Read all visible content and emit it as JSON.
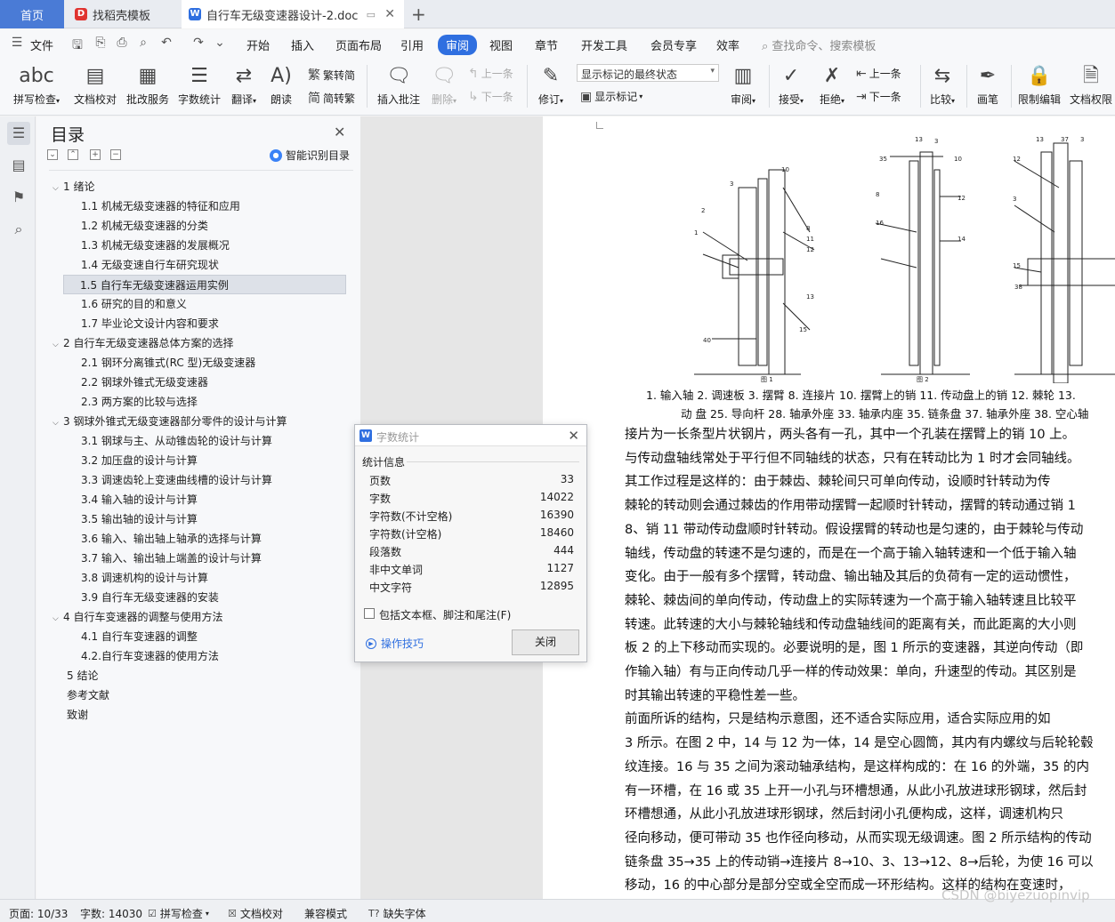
{
  "tabs": {
    "home": "首页",
    "t1": "找稻壳模板",
    "t2": "自行车无级变速器设计-2.doc"
  },
  "menubar": {
    "file": "文件",
    "items": [
      "开始",
      "插入",
      "页面布局",
      "引用",
      "审阅",
      "视图",
      "章节",
      "开发工具",
      "会员专享",
      "效率"
    ],
    "active": "审阅",
    "search_placeholder": "查找命令、搜索模板"
  },
  "ribbon": {
    "spell": "拼写检查",
    "doccheck": "文档校对",
    "batch": "批改服务",
    "wordcount": "字数统计",
    "translate": "翻译",
    "read": "朗读",
    "trad": "繁转简",
    "simp": "简转繁",
    "insert_comment": "插入批注",
    "delete": "删除",
    "prev_comment": "上一条",
    "next_comment": "下一条",
    "revise": "修订",
    "mark_state": "显示标记的最终状态",
    "show_marks": "显示标记",
    "review": "审阅",
    "accept": "接受",
    "reject": "拒绝",
    "prev": "上一条",
    "next": "下一条",
    "compare": "比较",
    "pen": "画笔",
    "restrict": "限制编辑",
    "permission": "文档权限"
  },
  "toc": {
    "title": "目录",
    "smart": "智能识别目录",
    "items": [
      {
        "text": "1 绪论"
      },
      {
        "text": "1.1    机械无级变速器的特征和应用"
      },
      {
        "text": "1.2   机械无级变速器的分类"
      },
      {
        "text": "1.3   机械无级变速器的发展概况"
      },
      {
        "text": "1.4   无级变速自行车研究现状"
      },
      {
        "text": "1.5  自行车无级变速器运用实例"
      },
      {
        "text": "1.6  研究的目的和意义"
      },
      {
        "text": "1.7  毕业论文设计内容和要求"
      },
      {
        "text": "2  自行车无级变速器总体方案的选择"
      },
      {
        "text": "2.1   钢环分离锥式(RC 型)无级变速器"
      },
      {
        "text": "2.2   钢球外锥式无级变速器"
      },
      {
        "text": "2.3   两方案的比较与选择"
      },
      {
        "text": "3  钢球外锥式无级变速器部分零件的设计与计算"
      },
      {
        "text": "3.1   钢球与主、从动锥齿轮的设计与计算"
      },
      {
        "text": "3.2   加压盘的设计与计算"
      },
      {
        "text": "3.3   调速齿轮上变速曲线槽的设计与计算"
      },
      {
        "text": "3.4   输入轴的设计与计算"
      },
      {
        "text": "3.5   输出轴的设计与计算"
      },
      {
        "text": "3.6   输入、输出轴上轴承的选择与计算"
      },
      {
        "text": "3.7   输入、输出轴上端盖的设计与计算"
      },
      {
        "text": "3.8   调速机构的设计与计算"
      },
      {
        "text": "3.9   自行车无级变速器的安装"
      },
      {
        "text": "4  自行车变速器的调整与使用方法"
      },
      {
        "text": "4.1  自行车变速器的调整"
      },
      {
        "text": "4.2.自行车变速器的使用方法"
      },
      {
        "text": "5  结论"
      },
      {
        "text": "参考文献"
      },
      {
        "text": "致谢"
      }
    ]
  },
  "dialog": {
    "title": "字数统计",
    "section": "统计信息",
    "rows": [
      {
        "k": "页数",
        "v": "33"
      },
      {
        "k": "字数",
        "v": "14022"
      },
      {
        "k": "字符数(不计空格)",
        "v": "16390"
      },
      {
        "k": "字符数(计空格)",
        "v": "18460"
      },
      {
        "k": "段落数",
        "v": "444"
      },
      {
        "k": "非中文单词",
        "v": "1127"
      },
      {
        "k": "中文字符",
        "v": "12895"
      }
    ],
    "checkbox": "包括文本框、脚注和尾注(F)",
    "tips": "操作技巧",
    "close": "关闭"
  },
  "doc": {
    "captions": [
      "1. 输入轴  2. 调速板  3. 摆臂  8. 连接片  10. 摆臂上的销  11. 传动盘上的销  12. 棘轮  13.",
      "动  盘  25. 导向杆  28. 轴承外座  33. 轴承内座  35. 链条盘  37. 轴承外座  38. 空心轴"
    ],
    "paragraphs": [
      "接片为一长条型片状钢片，两头各有一孔，其中一个孔装在摆臂上的销 10 上。",
      "与传动盘轴线常处于平行但不同轴线的状态，只有在转动比为 1 时才会同轴线。",
      "    其工作过程是这样的：由于棘齿、棘轮间只可单向传动，设顺时针转动为传",
      "棘轮的转动则会通过棘齿的作用带动摆臂一起顺时针转动，摆臂的转动通过销 1",
      "8、销 11 带动传动盘顺时针转动。假设摆臂的转动也是匀速的，由于棘轮与传动",
      "轴线，传动盘的转速不是匀速的，而是在一个高于输入轴转速和一个低于输入轴",
      "变化。由于一般有多个摆臂，转动盘、输出轴及其后的负荷有一定的运动惯性，",
      "棘轮、棘齿间的单向传动，传动盘上的实际转速为一个高于输入轴转速且比较平",
      "转速。此转速的大小与棘轮轴线和传动盘轴线间的距离有关，而此距离的大小则",
      "板 2 的上下移动而实现的。必要说明的是，图 1 所示的变速器，其逆向传动（即",
      "作输入轴）有与正向传动几乎一样的传动效果：单向，升速型的传动。其区别是",
      "时其输出转速的平稳性差一些。",
      "    前面所诉的结构，只是结构示意图，还不适合实际应用，适合实际应用的如",
      "3 所示。在图 2 中，14 与 12 为一体，14 是空心圆筒，其内有内螺纹与后轮轮毂",
      "纹连接。16 与 35 之间为滚动轴承结构，是这样构成的：在 16 的外端，35 的内",
      "有一环槽，在 16 或 35 上开一小孔与环槽想通，从此小孔放进球形钢球，然后封",
      "环槽想通，从此小孔放进球形钢球，然后封闭小孔便构成，这样，调速机构只",
      "径向移动，便可带动 35 也作径向移动，从而实现无级调速。图 2 所示结构的传动",
      "链条盘 35→35 上的传动销→连接片 8→10、3、13→12、8→后轮，为使 16 可以",
      "移动，16 的中心部分是部分空或全空而成一环形结构。这样的结构在变速时，"
    ],
    "figure_labels": [
      "图 1",
      "图 2"
    ]
  },
  "status": {
    "page": "页面: 10/33",
    "words": "字数: 14030",
    "spell": "拼写检查",
    "doccheck": "文档校对",
    "compat": "兼容模式",
    "missing_font": "缺失字体"
  },
  "watermark": "CSDN @biyezuopinvip"
}
